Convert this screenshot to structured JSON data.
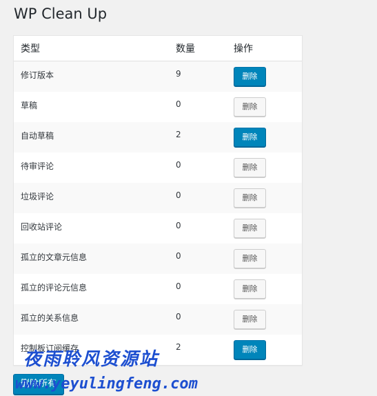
{
  "page": {
    "title": "WP Clean Up"
  },
  "table": {
    "headers": {
      "type": "类型",
      "count": "数量",
      "action": "操作"
    },
    "rows": [
      {
        "type": "修订版本",
        "count": "9",
        "button": "删除",
        "primary": true
      },
      {
        "type": "草稿",
        "count": "0",
        "button": "删除",
        "primary": false
      },
      {
        "type": "自动草稿",
        "count": "2",
        "button": "删除",
        "primary": true
      },
      {
        "type": "待审评论",
        "count": "0",
        "button": "删除",
        "primary": false
      },
      {
        "type": "垃圾评论",
        "count": "0",
        "button": "删除",
        "primary": false
      },
      {
        "type": "回收站评论",
        "count": "0",
        "button": "删除",
        "primary": false
      },
      {
        "type": "孤立的文章元信息",
        "count": "0",
        "button": "删除",
        "primary": false
      },
      {
        "type": "孤立的评论元信息",
        "count": "0",
        "button": "删除",
        "primary": false
      },
      {
        "type": "孤立的关系信息",
        "count": "0",
        "button": "删除",
        "primary": false
      },
      {
        "type": "控制板订阅缓存",
        "count": "2",
        "button": "删除",
        "primary": true
      }
    ]
  },
  "footer": {
    "delete_all_label": "删除所有"
  },
  "watermark": {
    "line1": "夜雨聆风资源站",
    "line2": "www.yeyulingfeng.com"
  },
  "colors": {
    "primary": "#0085ba",
    "watermark": "#1d4fd0"
  }
}
